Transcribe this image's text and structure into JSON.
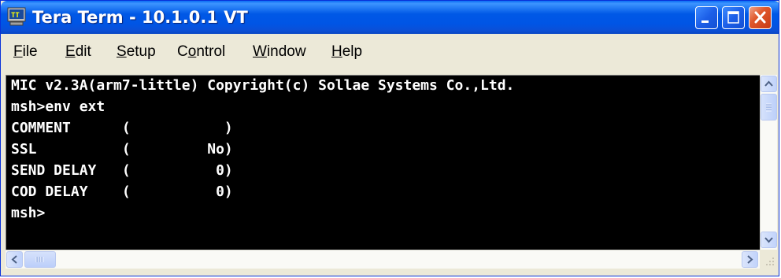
{
  "window": {
    "title": "Tera Term - 10.1.0.1 VT",
    "icons": {
      "app": "tera-term-icon",
      "minimize": "minimize-icon",
      "maximize": "maximize-icon",
      "close": "close-icon"
    }
  },
  "menu": {
    "file": {
      "underline": "F",
      "rest": "ile"
    },
    "edit": {
      "underline": "E",
      "rest": "dit"
    },
    "setup": {
      "underline": "S",
      "rest": "etup"
    },
    "control": {
      "pre": "C",
      "underline": "o",
      "rest": "ntrol"
    },
    "window": {
      "underline": "W",
      "rest": "indow"
    },
    "help": {
      "underline": "H",
      "rest": "elp"
    }
  },
  "terminal": {
    "lines": [
      "MIC v2.3A(arm7-little) Copyright(c) Sollae Systems Co.,Ltd.",
      "msh>env ext",
      "COMMENT      (           )",
      "SSL          (         No)",
      "SEND DELAY   (          0)",
      "COD DELAY    (          0)",
      "msh>"
    ]
  },
  "scrollbars": {
    "icons": {
      "up": "scroll-up-arrow-icon",
      "down": "scroll-down-arrow-icon",
      "left": "scroll-left-arrow-icon",
      "right": "scroll-right-arrow-icon"
    }
  },
  "colors": {
    "titlebar": "#0055e5",
    "terminal_bg": "#000000",
    "terminal_fg": "#ffffff",
    "close_button": "#e0582c"
  }
}
